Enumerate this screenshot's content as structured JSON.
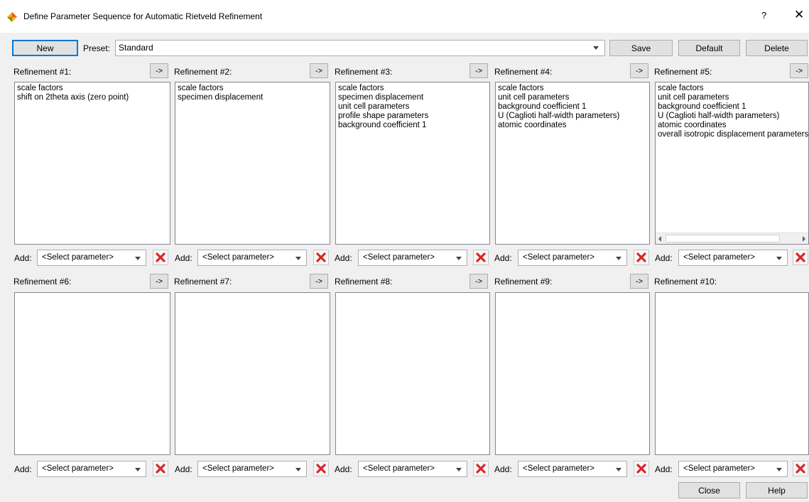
{
  "window": {
    "title": "Define Parameter Sequence for Automatic Rietveld Refinement",
    "help_glyph": "?",
    "close_glyph": "✕"
  },
  "toolbar": {
    "new_label": "New",
    "preset_label": "Preset:",
    "preset_value": "Standard",
    "save_label": "Save",
    "default_label": "Default",
    "delete_label": "Delete"
  },
  "panels": [
    {
      "title": "Refinement #1:",
      "arrow": "->",
      "items": [
        "scale factors",
        "shift on 2theta axis (zero point)"
      ]
    },
    {
      "title": "Refinement #2:",
      "arrow": "->",
      "items": [
        "scale factors",
        "specimen displacement"
      ]
    },
    {
      "title": "Refinement #3:",
      "arrow": "->",
      "items": [
        "scale factors",
        "specimen displacement",
        "unit cell parameters",
        "profile shape parameters",
        "background coefficient 1"
      ]
    },
    {
      "title": "Refinement #4:",
      "arrow": "->",
      "items": [
        "scale factors",
        "unit cell parameters",
        "background coefficient 1",
        "U (Caglioti half-width parameters)",
        "atomic coordinates"
      ]
    },
    {
      "title": "Refinement #5:",
      "arrow": "->",
      "items": [
        "scale factors",
        "unit cell parameters",
        "background coefficient 1",
        "U (Caglioti half-width parameters)",
        "atomic coordinates",
        "overall isotropic displacement parameters"
      ]
    },
    {
      "title": "Refinement #6:",
      "arrow": "->",
      "items": []
    },
    {
      "title": "Refinement #7:",
      "arrow": "->",
      "items": []
    },
    {
      "title": "Refinement #8:",
      "arrow": "->",
      "items": []
    },
    {
      "title": "Refinement #9:",
      "arrow": "->",
      "items": []
    },
    {
      "title": "Refinement #10:",
      "arrow": "",
      "items": []
    }
  ],
  "add_label": "Add:",
  "select_placeholder": "<Select parameter>",
  "footer": {
    "close_label": "Close",
    "help_label": "Help"
  },
  "colors": {
    "remove_icon": "#d9262b",
    "primary_border": "#0078d7"
  }
}
